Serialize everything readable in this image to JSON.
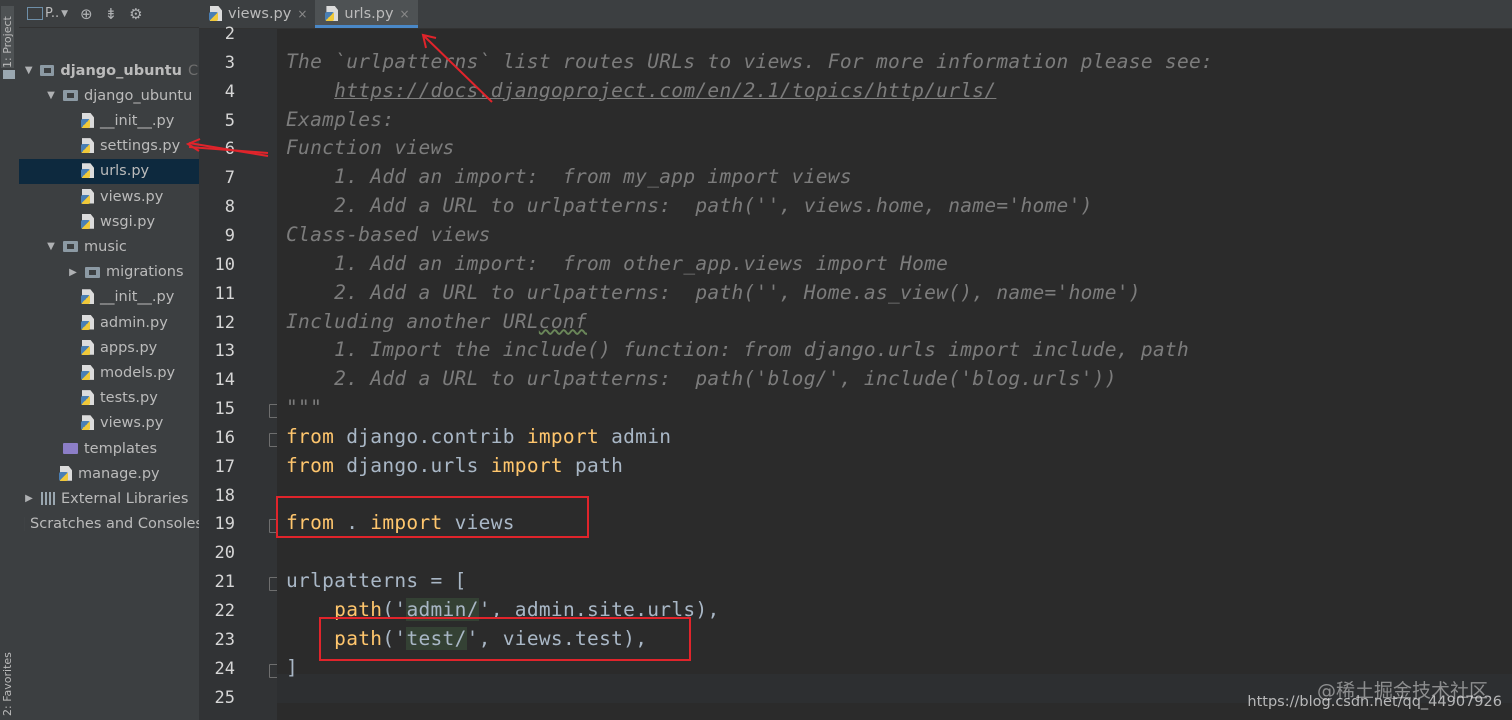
{
  "toolstrip": {
    "project_tab": "1: Project",
    "favorites_tab": "2: Favorites"
  },
  "project_panel": {
    "view_selector": "P..",
    "tree": [
      {
        "label": "django_ubuntu",
        "suffix": "C:",
        "depth": 0,
        "kind": "module-folder",
        "expanded": true,
        "bold": true
      },
      {
        "label": "django_ubuntu",
        "depth": 1,
        "kind": "module-folder",
        "expanded": true
      },
      {
        "label": "__init__.py",
        "depth": 2,
        "kind": "py"
      },
      {
        "label": "settings.py",
        "depth": 2,
        "kind": "py"
      },
      {
        "label": "urls.py",
        "depth": 2,
        "kind": "py",
        "selected": true
      },
      {
        "label": "views.py",
        "depth": 2,
        "kind": "py"
      },
      {
        "label": "wsgi.py",
        "depth": 2,
        "kind": "py"
      },
      {
        "label": "music",
        "depth": 1,
        "kind": "module-folder",
        "expanded": true
      },
      {
        "label": "migrations",
        "depth": 2,
        "kind": "module-folder",
        "expanded": false
      },
      {
        "label": "__init__.py",
        "depth": 2,
        "kind": "py"
      },
      {
        "label": "admin.py",
        "depth": 2,
        "kind": "py"
      },
      {
        "label": "apps.py",
        "depth": 2,
        "kind": "py"
      },
      {
        "label": "models.py",
        "depth": 2,
        "kind": "py"
      },
      {
        "label": "tests.py",
        "depth": 2,
        "kind": "py"
      },
      {
        "label": "views.py",
        "depth": 2,
        "kind": "py"
      },
      {
        "label": "templates",
        "depth": 1,
        "kind": "template-folder"
      },
      {
        "label": "manage.py",
        "depth": 1,
        "kind": "py"
      },
      {
        "label": "External Libraries",
        "depth": 0,
        "kind": "libraries",
        "expanded": false
      },
      {
        "label": "Scratches and Consoles",
        "depth": 0,
        "kind": "scratches"
      }
    ]
  },
  "editor_tabs": [
    {
      "label": "views.py",
      "close": "×",
      "active": false
    },
    {
      "label": "urls.py",
      "close": "×",
      "active": true
    }
  ],
  "editor": {
    "line_numbers": [
      "2",
      "3",
      "4",
      "5",
      "6",
      "7",
      "8",
      "9",
      "10",
      "11",
      "12",
      "13",
      "14",
      "15",
      "16",
      "17",
      "18",
      "19",
      "20",
      "21",
      "22",
      "23",
      "24",
      "25"
    ],
    "lines": [
      [
        {
          "t": "",
          "c": "doc"
        }
      ],
      [
        {
          "t": "The `urlpatterns` list routes URLs to views. For more information please see:",
          "c": "doc"
        }
      ],
      [
        {
          "t": "    ",
          "c": "doc"
        },
        {
          "t": "https://docs.djangoproject.com/en/2.1/topics/http/urls/",
          "c": "doc-link"
        }
      ],
      [
        {
          "t": "Examples:",
          "c": "doc"
        }
      ],
      [
        {
          "t": "Function views",
          "c": "doc"
        }
      ],
      [
        {
          "t": "    1. Add an import:  from my_app import views",
          "c": "doc"
        }
      ],
      [
        {
          "t": "    2. Add a URL to urlpatterns:  path('', views.home, name='home')",
          "c": "doc"
        }
      ],
      [
        {
          "t": "Class-based views",
          "c": "doc"
        }
      ],
      [
        {
          "t": "    1. Add an import:  from other_app.views import Home",
          "c": "doc"
        }
      ],
      [
        {
          "t": "    2. Add a URL to urlpatterns:  path('', Home.as_view(), name='home')",
          "c": "doc"
        }
      ],
      [
        {
          "t": "Including another URL",
          "c": "doc"
        },
        {
          "t": "conf",
          "c": "doc squig"
        }
      ],
      [
        {
          "t": "    1. Import the include() function: from django.urls import include, path",
          "c": "doc"
        }
      ],
      [
        {
          "t": "    2. Add a URL to urlpatterns:  path('blog/', include('blog.urls'))",
          "c": "doc"
        }
      ],
      [
        {
          "t": "\"\"\"",
          "c": "doc"
        }
      ],
      [
        {
          "t": "from",
          "c": "builtin"
        },
        {
          "t": " django.contrib ",
          "c": "ident"
        },
        {
          "t": "import",
          "c": "builtin"
        },
        {
          "t": " admin",
          "c": "ident"
        }
      ],
      [
        {
          "t": "from",
          "c": "builtin"
        },
        {
          "t": " django.urls ",
          "c": "ident"
        },
        {
          "t": "import",
          "c": "builtin"
        },
        {
          "t": " path",
          "c": "ident"
        }
      ],
      [
        {
          "t": "",
          "c": "ident"
        }
      ],
      [
        {
          "t": "from",
          "c": "builtin"
        },
        {
          "t": " . ",
          "c": "ident"
        },
        {
          "t": "import",
          "c": "builtin"
        },
        {
          "t": " views",
          "c": "ident"
        }
      ],
      [
        {
          "t": "",
          "c": "ident"
        }
      ],
      [
        {
          "t": "urlpatterns = [",
          "c": "ident"
        }
      ],
      [
        {
          "t": "    ",
          "c": "ident"
        },
        {
          "t": "path",
          "c": "builtin"
        },
        {
          "t": "('",
          "c": "ident"
        },
        {
          "t": "admin/",
          "c": "ident hl"
        },
        {
          "t": "', admin.site.urls),",
          "c": "ident"
        }
      ],
      [
        {
          "t": "    ",
          "c": "ident"
        },
        {
          "t": "path",
          "c": "builtin"
        },
        {
          "t": "('",
          "c": "ident"
        },
        {
          "t": "test/",
          "c": "ident hl"
        },
        {
          "t": "', views.test),",
          "c": "ident"
        }
      ],
      [
        {
          "t": "]",
          "c": "ident"
        }
      ],
      [
        {
          "t": "",
          "c": "ident"
        }
      ]
    ],
    "fold_marker_lines": [
      "15",
      "16",
      "19",
      "21",
      "24"
    ]
  },
  "watermark": {
    "site_cn": "@稀土掘金技术社区",
    "url": "https://blog.csdn.net/qq_44907926"
  },
  "colors": {
    "annotation_red": "#e0242b",
    "selection": "#0d293e",
    "tab_underline": "#4a88c7"
  }
}
